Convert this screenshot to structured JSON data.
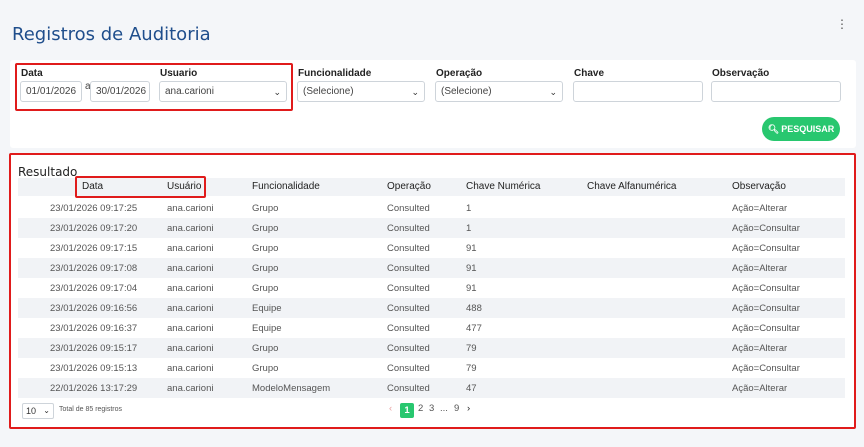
{
  "page": {
    "title": "Registros de Auditoria",
    "menu_icon": "kebab-vertical-icon"
  },
  "filters": {
    "data_label": "Data",
    "date_from": "01/01/2026",
    "date_sep": "a",
    "date_to": "30/01/2026",
    "usuario_label": "Usuario",
    "usuario_value": "ana.carioni",
    "funcionalidade_label": "Funcionalidade",
    "funcionalidade_value": "(Selecione)",
    "operacao_label": "Operação",
    "operacao_value": "(Selecione)",
    "chave_label": "Chave",
    "chave_value": "",
    "observacao_label": "Observação",
    "observacao_value": "",
    "search_label": "PESQUISAR"
  },
  "results": {
    "title": "Resultado",
    "columns": [
      "Data",
      "Usuário",
      "Funcionalidade",
      "Operação",
      "Chave Numérica",
      "Chave Alfanumérica",
      "Observação"
    ],
    "rows": [
      [
        "23/01/2026 09:17:25",
        "ana.carioni",
        "Grupo",
        "Consulted",
        "1",
        "",
        "Ação=Alterar"
      ],
      [
        "23/01/2026 09:17:20",
        "ana.carioni",
        "Grupo",
        "Consulted",
        "1",
        "",
        "Ação=Consultar"
      ],
      [
        "23/01/2026 09:17:15",
        "ana.carioni",
        "Grupo",
        "Consulted",
        "91",
        "",
        "Ação=Consultar"
      ],
      [
        "23/01/2026 09:17:08",
        "ana.carioni",
        "Grupo",
        "Consulted",
        "91",
        "",
        "Ação=Alterar"
      ],
      [
        "23/01/2026 09:17:04",
        "ana.carioni",
        "Grupo",
        "Consulted",
        "91",
        "",
        "Ação=Consultar"
      ],
      [
        "23/01/2026 09:16:56",
        "ana.carioni",
        "Equipe",
        "Consulted",
        "488",
        "",
        "Ação=Consultar"
      ],
      [
        "23/01/2026 09:16:37",
        "ana.carioni",
        "Equipe",
        "Consulted",
        "477",
        "",
        "Ação=Consultar"
      ],
      [
        "23/01/2026 09:15:17",
        "ana.carioni",
        "Grupo",
        "Consulted",
        "79",
        "",
        "Ação=Alterar"
      ],
      [
        "23/01/2026 09:15:13",
        "ana.carioni",
        "Grupo",
        "Consulted",
        "79",
        "",
        "Ação=Consultar"
      ],
      [
        "22/01/2026 13:17:29",
        "ana.carioni",
        "ModeloMensagem",
        "Consulted",
        "47",
        "",
        "Ação=Alterar"
      ]
    ],
    "page_size": "10",
    "total_text": "Total de 85 registros",
    "pagination": {
      "prev": "‹",
      "pages": [
        "1",
        "2",
        "3",
        "...",
        "9"
      ],
      "current": "1",
      "next": "›"
    }
  },
  "colors": {
    "accent": "#28c76f",
    "title": "#1f4e8c",
    "highlight": "#e01b1b"
  }
}
